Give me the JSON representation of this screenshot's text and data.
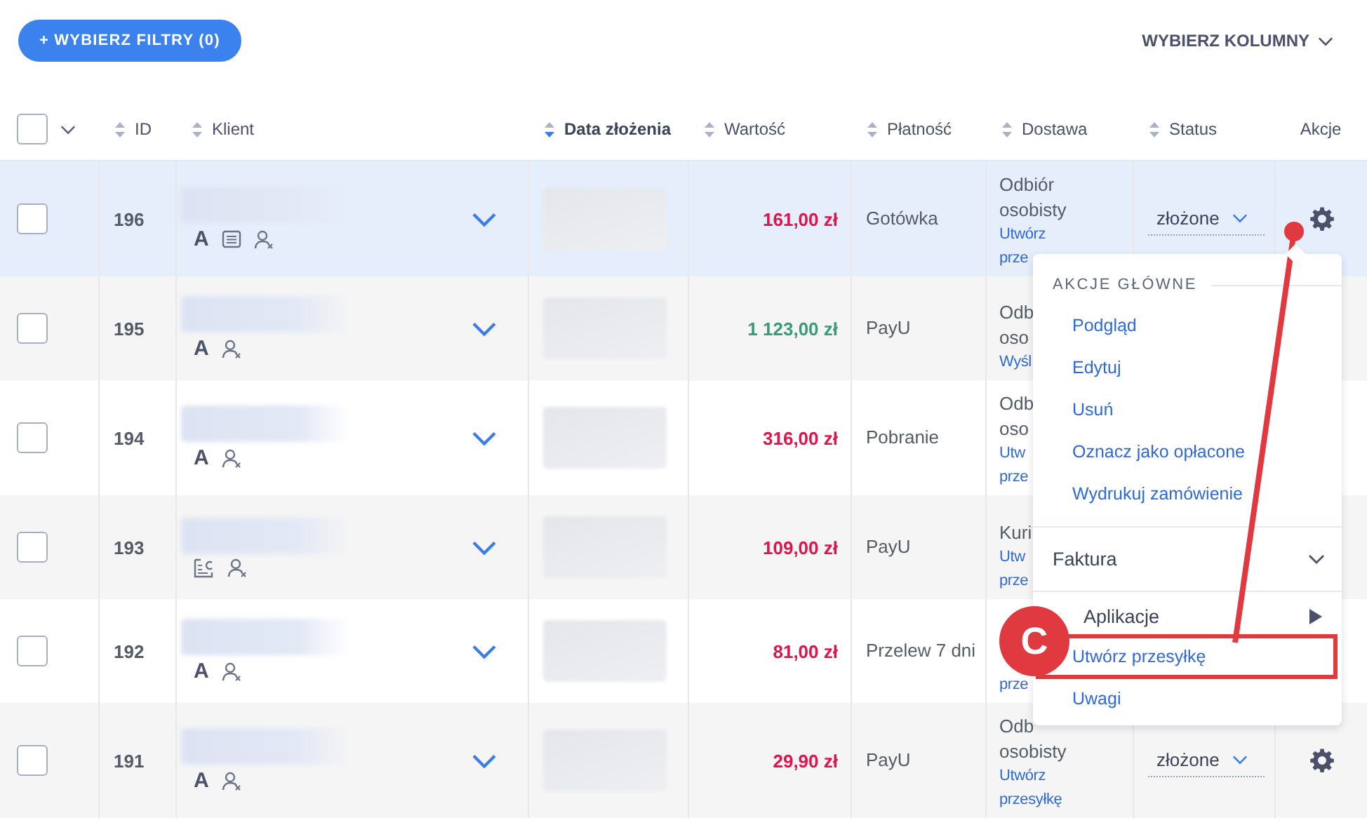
{
  "toolbar": {
    "filter_button": "+ WYBIERZ FILTRY (0)",
    "columns_button": "WYBIERZ KOLUMNY"
  },
  "table": {
    "select_all": {
      "checked": false
    },
    "columns": [
      {
        "label": "ID",
        "sortable": true,
        "sorted": false
      },
      {
        "label": "Klient",
        "sortable": true,
        "sorted": false
      },
      {
        "label": "Data złożenia",
        "sortable": true,
        "sorted": true
      },
      {
        "label": "Wartość",
        "sortable": true,
        "sorted": false
      },
      {
        "label": "Płatność",
        "sortable": true,
        "sorted": false
      },
      {
        "label": "Dostawa",
        "sortable": true,
        "sorted": false
      },
      {
        "label": "Status",
        "sortable": true,
        "sorted": false
      },
      {
        "label": "Akcje",
        "sortable": false
      }
    ],
    "rows": [
      {
        "id": "196",
        "checked": false,
        "selected": true,
        "client_icons": [
          {
            "kind": "letter",
            "text": "A"
          },
          {
            "kind": "note"
          },
          {
            "kind": "user-x"
          }
        ],
        "value": {
          "text": "161,00 zł",
          "color": "#e0134a"
        },
        "payment": "Gotówka",
        "delivery": [
          {
            "kind": "text",
            "text": "Odbiór"
          },
          {
            "kind": "text",
            "text": "osobisty"
          },
          {
            "kind": "link",
            "text": "Utwórz"
          },
          {
            "kind": "link",
            "text": "prze"
          }
        ],
        "actions": {
          "status": "złożone"
        }
      },
      {
        "id": "195",
        "checked": false,
        "selected": false,
        "client_icons": [
          {
            "kind": "letter",
            "text": "A"
          },
          {
            "kind": "user-x"
          }
        ],
        "value": {
          "text": "1 123,00 zł",
          "color": "#3b9a7c"
        },
        "payment": "PayU",
        "delivery": [
          {
            "kind": "text",
            "text": "Odb"
          },
          {
            "kind": "text",
            "text": "oso"
          },
          {
            "kind": "link",
            "text": "Wyśl"
          }
        ]
      },
      {
        "id": "194",
        "checked": false,
        "selected": false,
        "client_icons": [
          {
            "kind": "letter",
            "text": "A"
          },
          {
            "kind": "user-x"
          }
        ],
        "value": {
          "text": "316,00 zł",
          "color": "#e0134a"
        },
        "payment": "Pobranie",
        "delivery": [
          {
            "kind": "text",
            "text": "Odb"
          },
          {
            "kind": "text",
            "text": "oso"
          },
          {
            "kind": "link",
            "text": "Utw"
          },
          {
            "kind": "link",
            "text": "prze"
          }
        ]
      },
      {
        "id": "193",
        "checked": false,
        "selected": false,
        "client_icons": [
          {
            "kind": "card"
          },
          {
            "kind": "user-x"
          }
        ],
        "value": {
          "text": "109,00 zł",
          "color": "#e0134a"
        },
        "payment": "PayU",
        "delivery": [
          {
            "kind": "text",
            "text": "Kuri"
          },
          {
            "kind": "link",
            "text": "Utw"
          },
          {
            "kind": "link",
            "text": "prze"
          }
        ]
      },
      {
        "id": "192",
        "checked": false,
        "selected": false,
        "client_icons": [
          {
            "kind": "letter",
            "text": "A"
          },
          {
            "kind": "user-x"
          }
        ],
        "value": {
          "text": "81,00 zł",
          "color": "#e0134a"
        },
        "payment": "Przelew 7 dni",
        "delivery": [
          {
            "kind": "link",
            "text": "prze"
          }
        ]
      },
      {
        "id": "191",
        "checked": false,
        "selected": false,
        "client_icons": [
          {
            "kind": "letter",
            "text": "A"
          },
          {
            "kind": "user-x"
          }
        ],
        "value": {
          "text": "29,90 zł",
          "color": "#e0134a"
        },
        "payment": "PayU",
        "delivery": [
          {
            "kind": "text",
            "text": "Odb"
          },
          {
            "kind": "text",
            "text": "osobisty"
          },
          {
            "kind": "link",
            "text": "Utwórz"
          },
          {
            "kind": "link",
            "text": "przesyłkę"
          }
        ],
        "actions": {
          "status": "złożone"
        }
      }
    ]
  },
  "action_menu": {
    "items": [
      {
        "kind": "heading",
        "text": "AKCJE GŁÓWNE"
      },
      {
        "kind": "link",
        "text": "Podgląd"
      },
      {
        "kind": "link",
        "text": "Edytuj"
      },
      {
        "kind": "link",
        "text": "Usuń"
      },
      {
        "kind": "link",
        "text": "Oznacz jako opłacone"
      },
      {
        "kind": "link",
        "text": "Wydrukuj zamówienie"
      },
      {
        "kind": "submenu",
        "text": "Faktura",
        "expanded": false
      },
      {
        "kind": "flyout",
        "text": "Aplikacje"
      },
      {
        "kind": "framed-link",
        "text": "Utwórz przesyłkę"
      },
      {
        "kind": "link",
        "text": "Uwagi"
      }
    ]
  },
  "annotation": {
    "badge": "C"
  }
}
